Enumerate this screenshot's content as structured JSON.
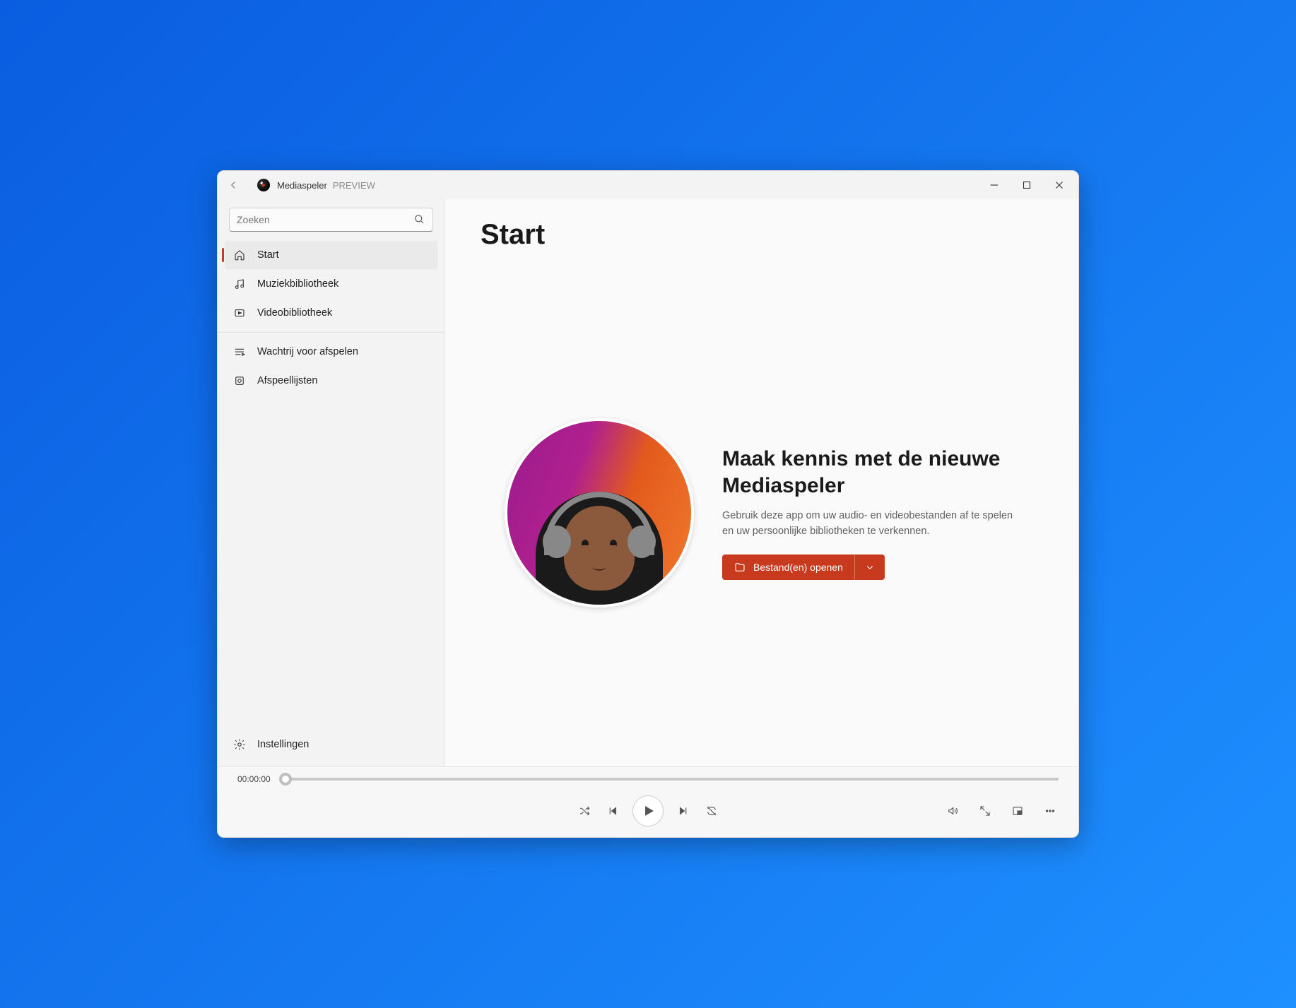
{
  "titlebar": {
    "app_name": "Mediaspeler",
    "preview_tag": "PREVIEW"
  },
  "search": {
    "placeholder": "Zoeken"
  },
  "sidebar": {
    "items": [
      {
        "label": "Start"
      },
      {
        "label": "Muziekbibliotheek"
      },
      {
        "label": "Videobibliotheek"
      },
      {
        "label": "Wachtrij voor afspelen"
      },
      {
        "label": "Afspeellijsten"
      }
    ],
    "settings_label": "Instellingen"
  },
  "main": {
    "page_title": "Start",
    "hero_title": "Maak kennis met de nieuwe Mediaspeler",
    "hero_desc": "Gebruik deze app om uw audio- en videobestanden af te spelen en uw persoonlijke bibliotheken te verkennen.",
    "open_btn": "Bestand(en) openen"
  },
  "player": {
    "time_elapsed": "00:00:00"
  }
}
